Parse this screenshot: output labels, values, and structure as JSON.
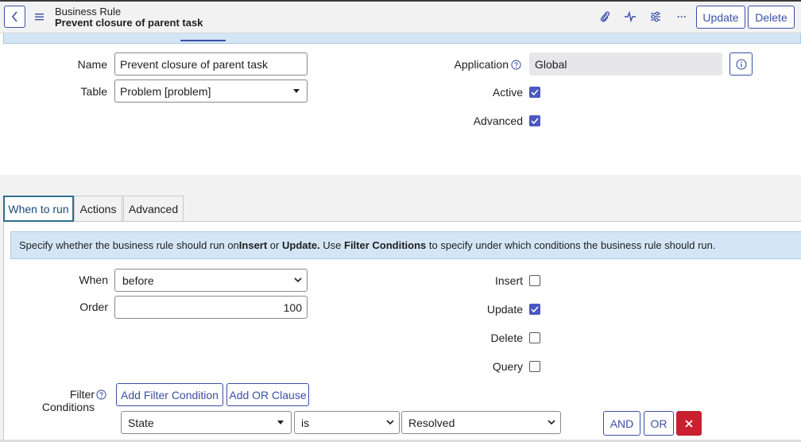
{
  "header": {
    "record_type": "Business Rule",
    "record_title": "Prevent closure of parent task",
    "update_label": "Update",
    "delete_label": "Delete",
    "more_label": "···"
  },
  "form": {
    "name_label": "Name",
    "name_value": "Prevent closure of parent task",
    "table_label": "Table",
    "table_value": "Problem [problem]",
    "application_label": "Application",
    "application_value": "Global",
    "active_label": "Active",
    "active_checked": true,
    "advanced_label": "Advanced",
    "advanced_checked": true
  },
  "tabs": [
    {
      "label": "When to run",
      "active": true
    },
    {
      "label": "Actions",
      "active": false
    },
    {
      "label": "Advanced",
      "active": false
    }
  ],
  "when_to_run": {
    "info": {
      "t1": "Specify whether the business rule should run on ",
      "b1": "Insert",
      "t2": " or ",
      "b2": "Update.",
      "t3": " Use ",
      "b3": "Filter Conditions",
      "t4": " to specify under which conditions the business rule should run."
    },
    "when_label": "When",
    "when_value": "before",
    "order_label": "Order",
    "order_value": "100",
    "insert_label": "Insert",
    "insert_checked": false,
    "update_label": "Update",
    "update_checked": true,
    "delete_label": "Delete",
    "delete_checked": false,
    "query_label": "Query",
    "query_checked": false,
    "filter_label": "Filter Conditions",
    "add_filter_label": "Add Filter Condition",
    "add_or_label": "Add OR Clause",
    "condition": {
      "field": "State",
      "operator": "is",
      "value": "Resolved",
      "and_label": "AND",
      "or_label": "OR"
    }
  },
  "colors": {
    "accent": "#3b4fa8",
    "checkbox": "#4a58c2",
    "info_bg": "#d4e6f6",
    "danger": "#c8202f"
  }
}
